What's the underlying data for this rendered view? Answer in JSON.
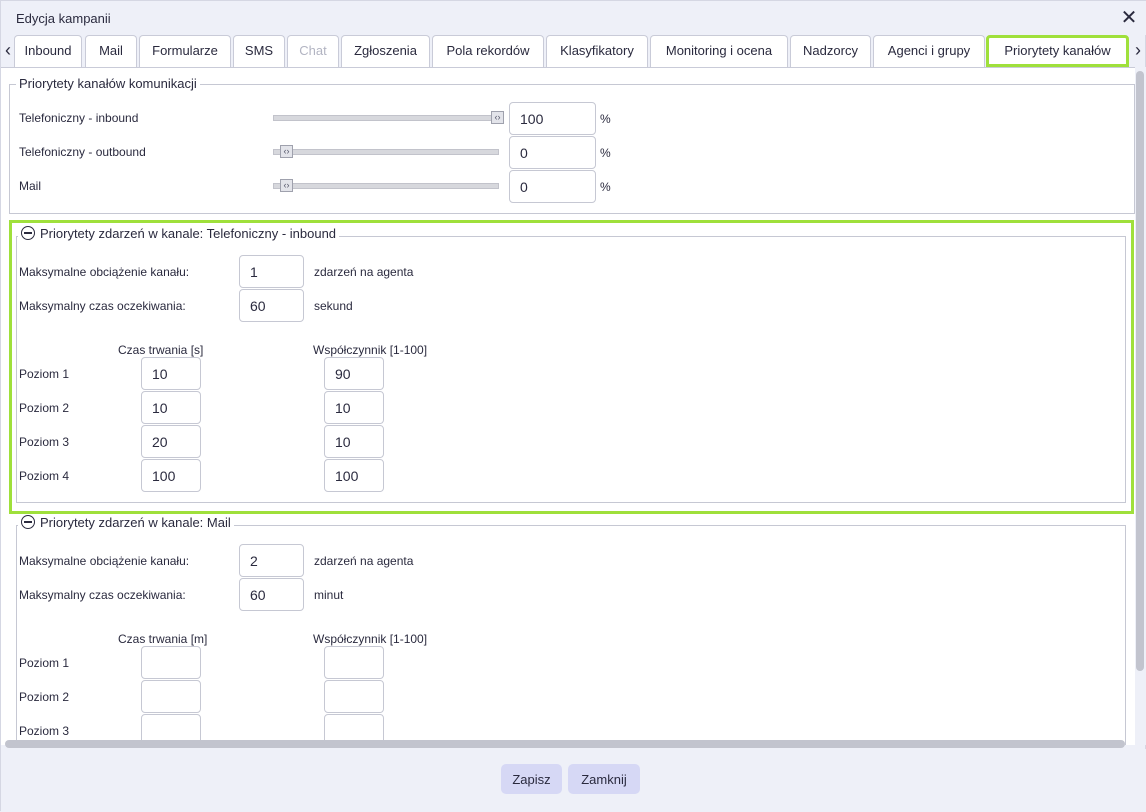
{
  "dialog": {
    "title": "Edycja kampanii"
  },
  "tabs": [
    {
      "label": "Inbound",
      "state": "normal"
    },
    {
      "label": "Mail",
      "state": "normal"
    },
    {
      "label": "Formularze",
      "state": "normal"
    },
    {
      "label": "SMS",
      "state": "normal"
    },
    {
      "label": "Chat",
      "state": "disabled"
    },
    {
      "label": "Zgłoszenia",
      "state": "normal"
    },
    {
      "label": "Pola rekordów",
      "state": "normal"
    },
    {
      "label": "Klasyfikatory",
      "state": "normal"
    },
    {
      "label": "Monitoring i ocena",
      "state": "normal"
    },
    {
      "label": "Nadzorcy",
      "state": "normal"
    },
    {
      "label": "Agenci i grupy",
      "state": "normal"
    },
    {
      "label": "Priorytety kanałów",
      "state": "active"
    }
  ],
  "channels": {
    "legend": "Priorytety kanałów komunikacji",
    "unit": "%",
    "rows": [
      {
        "label": "Telefoniczny - inbound",
        "value": "100",
        "level": 100
      },
      {
        "label": "Telefoniczny - outbound",
        "value": "0",
        "level": 0
      },
      {
        "label": "Mail",
        "value": "0",
        "level": 0
      }
    ]
  },
  "phone_inbound": {
    "legend": "Priorytety zdarzeń w kanale: Telefoniczny - inbound",
    "max_load_label": "Maksymalne obciążenie kanału:",
    "max_load_value": "1",
    "max_load_unit": "zdarzeń na agenta",
    "max_wait_label": "Maksymalny czas oczekiwania:",
    "max_wait_value": "60",
    "max_wait_unit": "sekund",
    "col_duration": "Czas trwania [s]",
    "col_factor": "Współczynnik [1-100]",
    "levels": [
      {
        "label": "Poziom 1",
        "duration": "10",
        "factor": "90"
      },
      {
        "label": "Poziom 2",
        "duration": "10",
        "factor": "10"
      },
      {
        "label": "Poziom 3",
        "duration": "20",
        "factor": "10"
      },
      {
        "label": "Poziom 4",
        "duration": "100",
        "factor": "100"
      }
    ]
  },
  "mail": {
    "legend": "Priorytety zdarzeń w kanale: Mail",
    "max_load_label": "Maksymalne obciążenie kanału:",
    "max_load_value": "2",
    "max_load_unit": "zdarzeń na agenta",
    "max_wait_label": "Maksymalny czas oczekiwania:",
    "max_wait_value": "60",
    "max_wait_unit": "minut",
    "col_duration": "Czas trwania [m]",
    "col_factor": "Współczynnik [1-100]",
    "levels": [
      {
        "label": "Poziom 1",
        "duration": "",
        "factor": ""
      },
      {
        "label": "Poziom 2",
        "duration": "",
        "factor": ""
      },
      {
        "label": "Poziom 3",
        "duration": "",
        "factor": ""
      }
    ]
  },
  "footer": {
    "save_label": "Zapisz",
    "close_label": "Zamknij"
  },
  "icons": {
    "close": "close-icon",
    "tab_prev": "chevron-left-icon",
    "tab_next": "chevron-right-icon",
    "collapse": "collapse-minus-icon",
    "slider_grip": "slider-grip-icon"
  },
  "colors": {
    "highlight": "#9fe03b",
    "button": "#d6d8f5"
  }
}
